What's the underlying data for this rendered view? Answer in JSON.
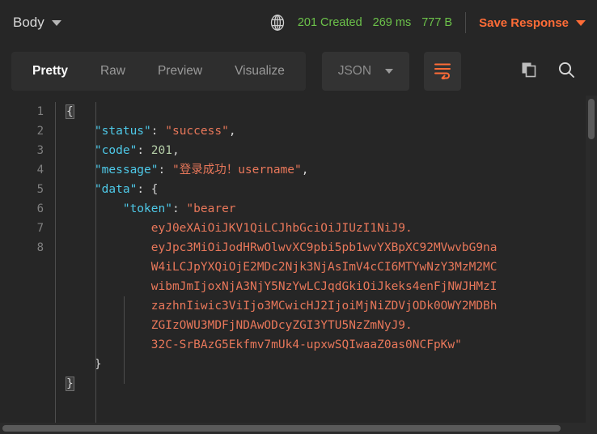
{
  "statusbar": {
    "body_label": "Body",
    "globe_icon": "globe-icon",
    "status_code": "201 Created",
    "time": "269 ms",
    "size": "777 B",
    "save_response": "Save Response",
    "green": "#6cc24a",
    "accent": "#ff6c37"
  },
  "tabs": [
    {
      "label": "Pretty",
      "active": true
    },
    {
      "label": "Raw",
      "active": false
    },
    {
      "label": "Preview",
      "active": false
    },
    {
      "label": "Visualize",
      "active": false
    }
  ],
  "format_select": {
    "value": "JSON"
  },
  "actions": {
    "wrap_lines_icon": "wrap-lines-icon",
    "copy_icon": "copy-icon",
    "search_icon": "search-icon"
  },
  "code": {
    "line_numbers": [
      "1",
      "2",
      "3",
      "4",
      "5",
      "6",
      "7",
      "8"
    ],
    "lines": [
      {
        "num": "1",
        "segments": [
          {
            "t": "{",
            "c": "p hl"
          }
        ]
      },
      {
        "num": "2",
        "segments": [
          {
            "t": "    ",
            "c": "p"
          },
          {
            "t": "\"status\"",
            "c": "k"
          },
          {
            "t": ": ",
            "c": "p"
          },
          {
            "t": "\"success\"",
            "c": "s"
          },
          {
            "t": ",",
            "c": "p"
          }
        ]
      },
      {
        "num": "3",
        "segments": [
          {
            "t": "    ",
            "c": "p"
          },
          {
            "t": "\"code\"",
            "c": "k"
          },
          {
            "t": ": ",
            "c": "p"
          },
          {
            "t": "201",
            "c": "n"
          },
          {
            "t": ",",
            "c": "p"
          }
        ]
      },
      {
        "num": "4",
        "segments": [
          {
            "t": "    ",
            "c": "p"
          },
          {
            "t": "\"message\"",
            "c": "k"
          },
          {
            "t": ": ",
            "c": "p"
          },
          {
            "t": "\"登录成功！username\"",
            "c": "s"
          },
          {
            "t": ",",
            "c": "p"
          }
        ]
      },
      {
        "num": "5",
        "segments": [
          {
            "t": "    ",
            "c": "p"
          },
          {
            "t": "\"data\"",
            "c": "k"
          },
          {
            "t": ": ",
            "c": "p"
          },
          {
            "t": "{",
            "c": "p"
          }
        ]
      },
      {
        "num": "6",
        "segments": [
          {
            "t": "        ",
            "c": "p"
          },
          {
            "t": "\"token\"",
            "c": "k"
          },
          {
            "t": ": ",
            "c": "p"
          },
          {
            "t": "\"bearer",
            "c": "s"
          }
        ]
      },
      {
        "num": "",
        "segments": [
          {
            "t": "            eyJ0eXAiOiJKV1QiLCJhbGciOiJIUzI1NiJ9.",
            "c": "s"
          }
        ]
      },
      {
        "num": "",
        "segments": [
          {
            "t": "            eyJpc3MiOiJodHRwOlwvXC9pbi5pb1wvYXBpXC92MVwvbG9na",
            "c": "s"
          }
        ]
      },
      {
        "num": "",
        "segments": [
          {
            "t": "            W4iLCJpYXQiOjE2MDc2Njk3NjAsImV4cCI6MTYwNzY3MzM2MC",
            "c": "s"
          }
        ]
      },
      {
        "num": "",
        "segments": [
          {
            "t": "            wibmJmIjoxNjA3NjY5NzYwLCJqdGkiOiJkeks4enFjNWJHMzI",
            "c": "s"
          }
        ]
      },
      {
        "num": "",
        "segments": [
          {
            "t": "            zazhnIiwic3ViIjo3MCwicHJ2IjoiMjNiZDVjODk0OWY2MDBh",
            "c": "s"
          }
        ]
      },
      {
        "num": "",
        "segments": [
          {
            "t": "            ZGIzOWU3MDFjNDAwODcyZGI3YTU5NzZmNyJ9.",
            "c": "s"
          }
        ]
      },
      {
        "num": "",
        "segments": [
          {
            "t": "            32C-SrBAzG5Ekfmv7mUk4-upxwSQIwaaZ0as0NCFpKw\"",
            "c": "s"
          }
        ]
      },
      {
        "num": "7",
        "segments": [
          {
            "t": "    }",
            "c": "p"
          }
        ]
      },
      {
        "num": "8",
        "segments": [
          {
            "t": "}",
            "c": "p hl"
          }
        ]
      }
    ],
    "full_token": "bearer eyJ0eXAiOiJKV1QiLCJhbGciOiJIUzI1NiJ9.eyJpc3MiOiJodHRwOlwvXC9pbi5pb1wvYXBpXC92MVwvbG9naW4iLCJpYXQiOjE2MDc2Njk3NjAsImV4cCI6MTYwNzY3MzM2MCwibmJmIjoxNjA3NjY5NzYwLCJqdGkiOiJkeks4enFjNWJHMzIzazhnIiwic3ViIjo3MCwicHJ2IjoiMjNiZDVjODk0OWY2MDBhZGIzOWU3MDFjNDAwODcyZGI3YTU5NzZmNyJ9.32C-SrBAzG5Ekfmv7mUk4-upxwSQIwaaZ0as0NCFpKw"
  }
}
